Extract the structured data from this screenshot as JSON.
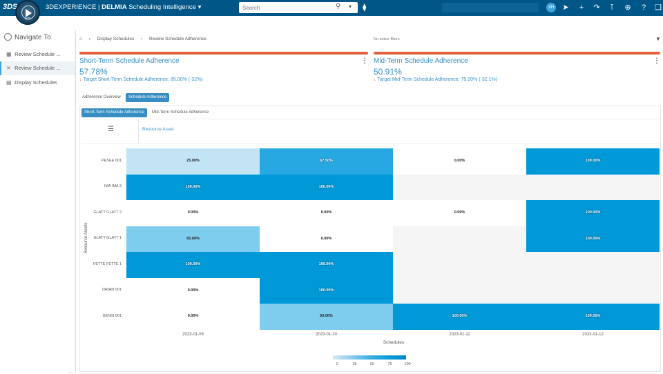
{
  "topbar": {
    "brand_logo": "3DS",
    "compass_label": "V.R",
    "platform": "3DEXPERIENCE",
    "app_brand": "DELMIA",
    "app_name": "Scheduling Intelligence",
    "search_placeholder": "Search",
    "user_initials": "XH",
    "colors": {
      "bar": "#005686",
      "avatar": "#42a2da"
    }
  },
  "sidebar": {
    "title": "Navigate To",
    "items": [
      {
        "label": "Review Schedule ...",
        "icon": "dashboard-icon",
        "active": false
      },
      {
        "label": "Review Schedule ...",
        "icon": "shuffle-icon",
        "active": true
      },
      {
        "label": "Display Schedules",
        "icon": "chart-doc-icon",
        "active": false
      }
    ],
    "bottom_mark": "..."
  },
  "breadcrumb": [
    "Display Schedules",
    "Review Schedule Adherence"
  ],
  "filters_text": "No active filters",
  "cards": [
    {
      "title": "Short-Term Schedule Adherence",
      "value": "57.78%",
      "target": "Target Short-Term Schedule Adherence: 85.00% (-32%)"
    },
    {
      "title": "Mid-Term Schedule Adherence",
      "value": "50.91%",
      "target": "Target Mid-Term Schedule Adherence: 75.00% (-32.1%)"
    }
  ],
  "tabs": [
    "Adherence Overview",
    "Schedule Adherence"
  ],
  "subtabs": [
    "Short-Term Schedule Adherence",
    "Mid-Term Schedule Adherence"
  ],
  "resource_header": "Resource Asset",
  "accent_color": "#368ec4",
  "status_color": "#e45f3c",
  "chart_data": {
    "type": "heatmap",
    "xlabel": "Schedules",
    "ylabel": "Resource Assets",
    "x": [
      "2023-01-09",
      "2023-01-10",
      "2023-01-11",
      "2023-01-12"
    ],
    "y": [
      "PESEE 001",
      "IMA IMA 3",
      "GLATT GLATT 2",
      "GLATT GLATT 1",
      "FETTE FETTE 1",
      "DRIAN 001",
      "DENSI 001"
    ],
    "values": [
      [
        25,
        67.5,
        0,
        100
      ],
      [
        100,
        100,
        null,
        null
      ],
      [
        0,
        0,
        0,
        100
      ],
      [
        50,
        0,
        null,
        100
      ],
      [
        100,
        100,
        null,
        null
      ],
      [
        0,
        100,
        null,
        null
      ],
      [
        0,
        50,
        100,
        100
      ]
    ],
    "labels": [
      [
        "25.00%",
        "67.50%",
        "0.00%",
        "100.00%"
      ],
      [
        "100.00%",
        "100.00%",
        "",
        ""
      ],
      [
        "0.00%",
        "0.00%",
        "0.00%",
        "100.00%"
      ],
      [
        "50.00%",
        "0.00%",
        "",
        "100.00%"
      ],
      [
        "100.00%",
        "100.00%",
        "",
        ""
      ],
      [
        "0.00%",
        "100.00%",
        "",
        ""
      ],
      [
        "0.00%",
        "50.00%",
        "100.00%",
        "100.00%"
      ]
    ],
    "legend_ticks": [
      "0",
      "25",
      "50",
      "75",
      "100"
    ],
    "color_scale": [
      "#d4eaf6",
      "#8ccceb",
      "#3fb0e4",
      "#0b9fd9",
      "#0086c5"
    ],
    "empty_color": "#f5f5f5",
    "zero_color": "#ffffff"
  }
}
